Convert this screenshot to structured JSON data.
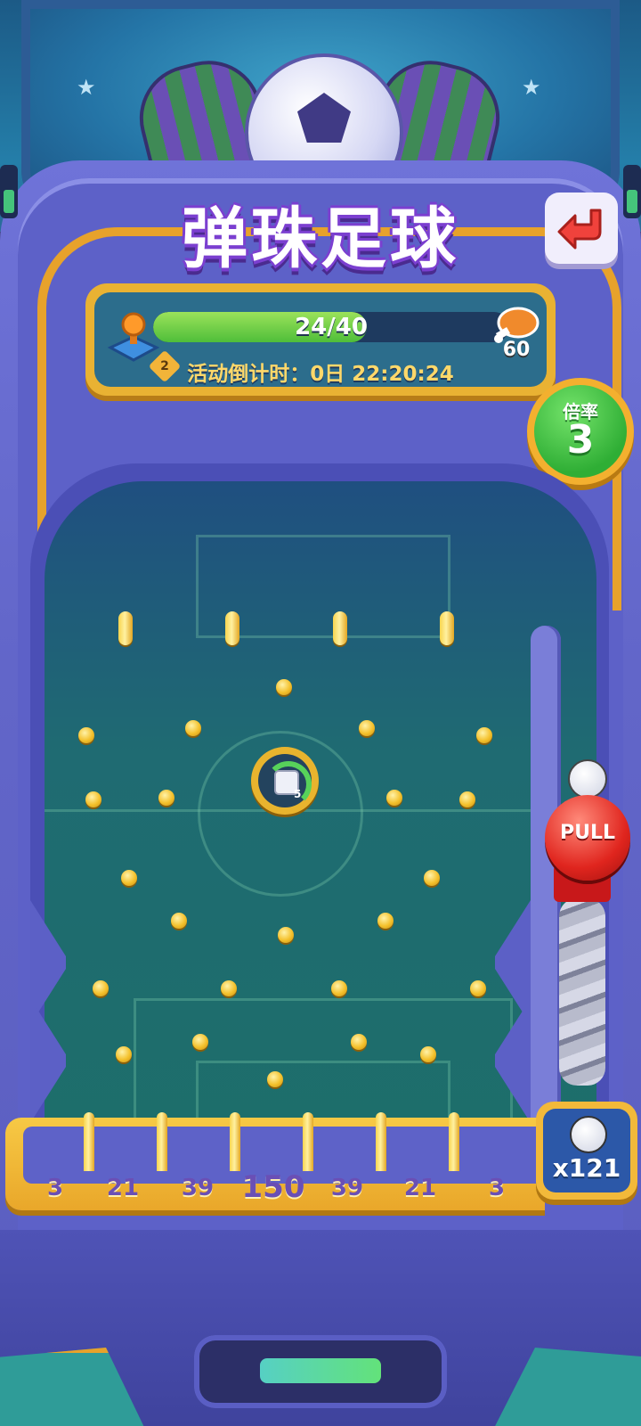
{
  "title": "弹珠足球",
  "progress": {
    "current_text": "24/40",
    "fraction": 0.6,
    "level": "2",
    "reward": "60",
    "countdown": "活动倒计时：0日 22:20:24"
  },
  "multiplier": {
    "label": "倍率",
    "value": "3"
  },
  "dice_bonus": {
    "count": "5",
    "fill_fraction": 0.3
  },
  "plunger": {
    "label": "PULL"
  },
  "slots": [
    "3",
    "21",
    "39",
    "150",
    "39",
    "21",
    "3"
  ],
  "balls": {
    "count": "x121"
  },
  "icons": {
    "back": "return-arrow-icon",
    "joystick": "joystick-icon",
    "reward": "drumstick-icon",
    "ball": "soccer-ball-icon",
    "dice": "dice-icon"
  },
  "colors": {
    "gold": "#e9a72a",
    "machine": "#6266c9",
    "field": "#1d6e6a",
    "multiplier_green": "#2fae35",
    "pull_red": "#e0251e"
  }
}
